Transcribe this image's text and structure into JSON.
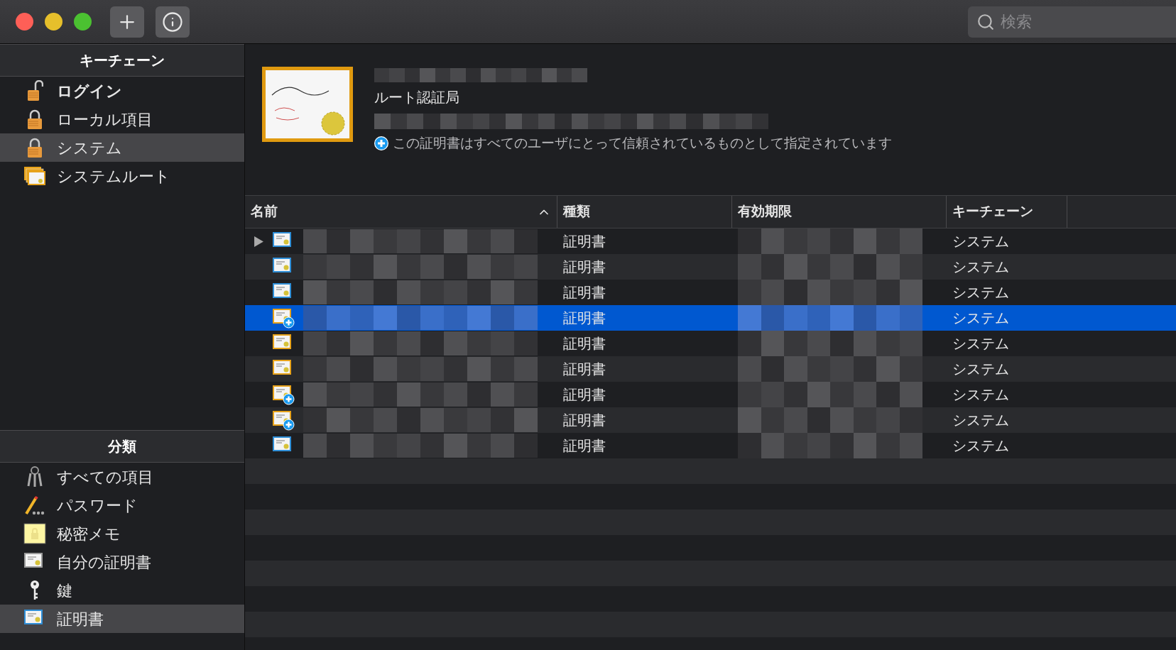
{
  "toolbar": {
    "search": {
      "placeholder": "検索"
    }
  },
  "sidebar": {
    "sections": [
      {
        "title": "キーチェーン",
        "items": [
          {
            "label": "ログイン",
            "kind": "unlocked",
            "default": true,
            "selected": false
          },
          {
            "label": "ローカル項目",
            "kind": "locked",
            "default": false,
            "selected": false
          },
          {
            "label": "システム",
            "kind": "locked",
            "default": false,
            "selected": true
          },
          {
            "label": "システムルート",
            "kind": "certstack",
            "default": false,
            "selected": false
          }
        ]
      },
      {
        "title": "分類",
        "items": [
          {
            "label": "すべての項目",
            "kind": "keys",
            "default": false,
            "selected": false
          },
          {
            "label": "パスワード",
            "kind": "pencil",
            "default": false,
            "selected": false
          },
          {
            "label": "秘密メモ",
            "kind": "note",
            "default": false,
            "selected": false
          },
          {
            "label": "自分の証明書",
            "kind": "mycert",
            "default": false,
            "selected": false
          },
          {
            "label": "鍵",
            "kind": "key",
            "default": false,
            "selected": false
          },
          {
            "label": "証明書",
            "kind": "cert",
            "default": false,
            "selected": true
          }
        ]
      }
    ]
  },
  "detail": {
    "subtitle": "ルート認証局",
    "trust_note": "この証明書はすべてのユーザにとって信頼されているものとして指定されています"
  },
  "table": {
    "columns": [
      {
        "label": "名前",
        "sorted": true
      },
      {
        "label": "種類",
        "sorted": false
      },
      {
        "label": "有効期限",
        "sorted": false
      },
      {
        "label": "キーチェーン",
        "sorted": false
      }
    ],
    "rows": [
      {
        "kind": "blue",
        "trusted": false,
        "expandable": true,
        "selected": false,
        "kind_text": "証明書",
        "keychain": "システム"
      },
      {
        "kind": "blue",
        "trusted": false,
        "expandable": false,
        "selected": false,
        "kind_text": "証明書",
        "keychain": "システム"
      },
      {
        "kind": "blue",
        "trusted": false,
        "expandable": false,
        "selected": false,
        "kind_text": "証明書",
        "keychain": "システム"
      },
      {
        "kind": "gold",
        "trusted": true,
        "expandable": false,
        "selected": true,
        "kind_text": "証明書",
        "keychain": "システム"
      },
      {
        "kind": "gold",
        "trusted": false,
        "expandable": false,
        "selected": false,
        "kind_text": "証明書",
        "keychain": "システム"
      },
      {
        "kind": "gold",
        "trusted": false,
        "expandable": false,
        "selected": false,
        "kind_text": "証明書",
        "keychain": "システム"
      },
      {
        "kind": "gold",
        "trusted": true,
        "expandable": false,
        "selected": false,
        "kind_text": "証明書",
        "keychain": "システム"
      },
      {
        "kind": "gold",
        "trusted": true,
        "expandable": false,
        "selected": false,
        "kind_text": "証明書",
        "keychain": "システム"
      },
      {
        "kind": "blue",
        "trusted": false,
        "expandable": false,
        "selected": false,
        "kind_text": "証明書",
        "keychain": "システム"
      }
    ]
  }
}
